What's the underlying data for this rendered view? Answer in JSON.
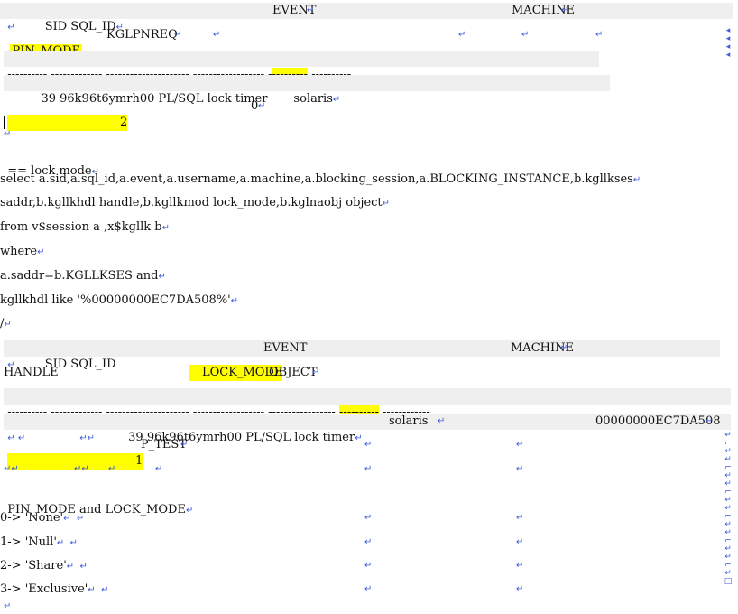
{
  "table1": {
    "header_a": "        SID SQL_ID",
    "header_b": "EVENT",
    "header_c": "MACHINE",
    "header2_pin": "PIN_MODE",
    "header2_rest": "KGLPNREQ",
    "dashes_a": "---------- ------------- --------------------- ------------------ -",
    "dashes_hl": "---------",
    "dashes_b": " ----------",
    "row_a": "         39 96k96t6ymrh00 PL/SQL lock timer       solaris",
    "row_pin": "         2",
    "row_req": "0"
  },
  "section_title": "== lock mode",
  "sql": {
    "line1": "select a.sid,a.sql_id,a.event,a.username,a.machine,a.blocking_session,a.BLOCKING_INSTANCE,b.kgllkses",
    "line2": "saddr,b.kgllkhdl handle,b.kgllkmod lock_mode,b.kglnaobj object",
    "line3": "from v$session a ,x$kgllk b",
    "line4": "where",
    "line5": "a.saddr=b.KGLLKSES and",
    "line6": "kgllkhdl like '%00000000EC7DA508%'",
    "line7": "/"
  },
  "table2": {
    "header_a": "        SID SQL_ID",
    "header_b": "EVENT",
    "header_c": "MACHINE",
    "header2_handle": "HANDLE",
    "header2_lock": "LOCK_MODE",
    "header2_obj": "OBJECT",
    "dashes_a": "---------- ------------- --------------------- ------------------ ----------------- ",
    "dashes_hl": "----------",
    "dashes_b": " ------------",
    "row_a": "         39 96k96t6ymrh00 PL/SQL lock timer",
    "row_machine": "solaris",
    "row_handle": "00000000EC7DA508",
    "row_lock": "1",
    "row_obj": "P_TEST"
  },
  "modes": {
    "title": "PIN_MODE and LOCK_MODE",
    "m0": "0-> 'None'",
    "m1": "1-> 'Null'",
    "m2": "2-> 'Share'",
    "m3": "3-> 'Exclusive'"
  },
  "colors": {
    "highlight": "#ffff00",
    "shade": "#efefef",
    "marks": "#3b5bd9"
  },
  "icons": {
    "paragraph_mark": "return-arrow-icon"
  }
}
